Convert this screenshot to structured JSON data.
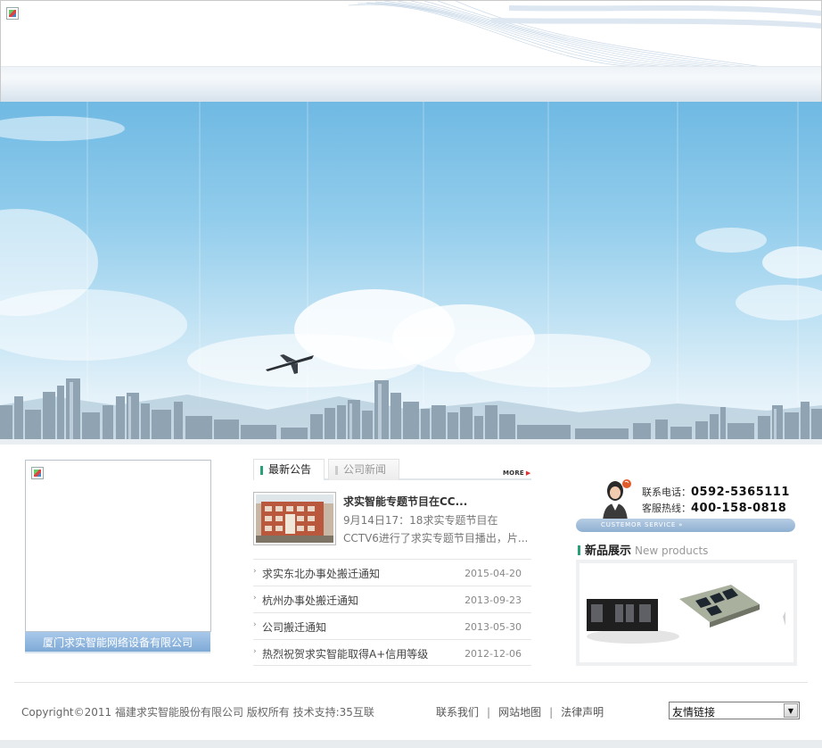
{
  "icons": {
    "header_logo": "broken-image-icon",
    "left_image": "broken-image-icon",
    "list_bullet": "chevron-right-icon",
    "more_arrow": "triangle-right-icon",
    "select_arrow": "chevron-down-icon"
  },
  "colors": {
    "accent_green": "#2aa07a",
    "caption_blue": "#7ea9d6"
  },
  "left_panel": {
    "caption": "厦门求实智能网络设备有限公司"
  },
  "news_tabs": [
    {
      "label": "最新公告",
      "active": true
    },
    {
      "label": "公司新闻",
      "active": false
    }
  ],
  "more_label": "MORE",
  "featured": {
    "title": "求实智能专题节目在CC...",
    "desc": "9月14日17：18求实专题节目在CCTV6进行了求实专题节目播出，片..."
  },
  "news": [
    {
      "title": "求实东北办事处搬迁通知",
      "date": "2015-04-20"
    },
    {
      "title": "杭州办事处搬迁通知",
      "date": "2013-09-23"
    },
    {
      "title": "公司搬迁通知",
      "date": "2013-05-30"
    },
    {
      "title": "热烈祝贺求实智能取得A+信用等级",
      "date": "2012-12-06"
    }
  ],
  "contact": {
    "phone_label": "联系电话：",
    "phone": "0592-5365111",
    "hotline_label": "客服热线：",
    "hotline": "400-158-0818",
    "service_label": "CUSTEMOR SERVICE  »"
  },
  "products": {
    "title": "新品展示",
    "subtitle": "New products"
  },
  "footer": {
    "copyright": "Copyright©2011 福建求实智能股份有限公司 版权所有 技术支持:35互联",
    "links": [
      "联系我们",
      "网站地图",
      "法律声明"
    ],
    "friend_links_selected": "友情链接"
  }
}
